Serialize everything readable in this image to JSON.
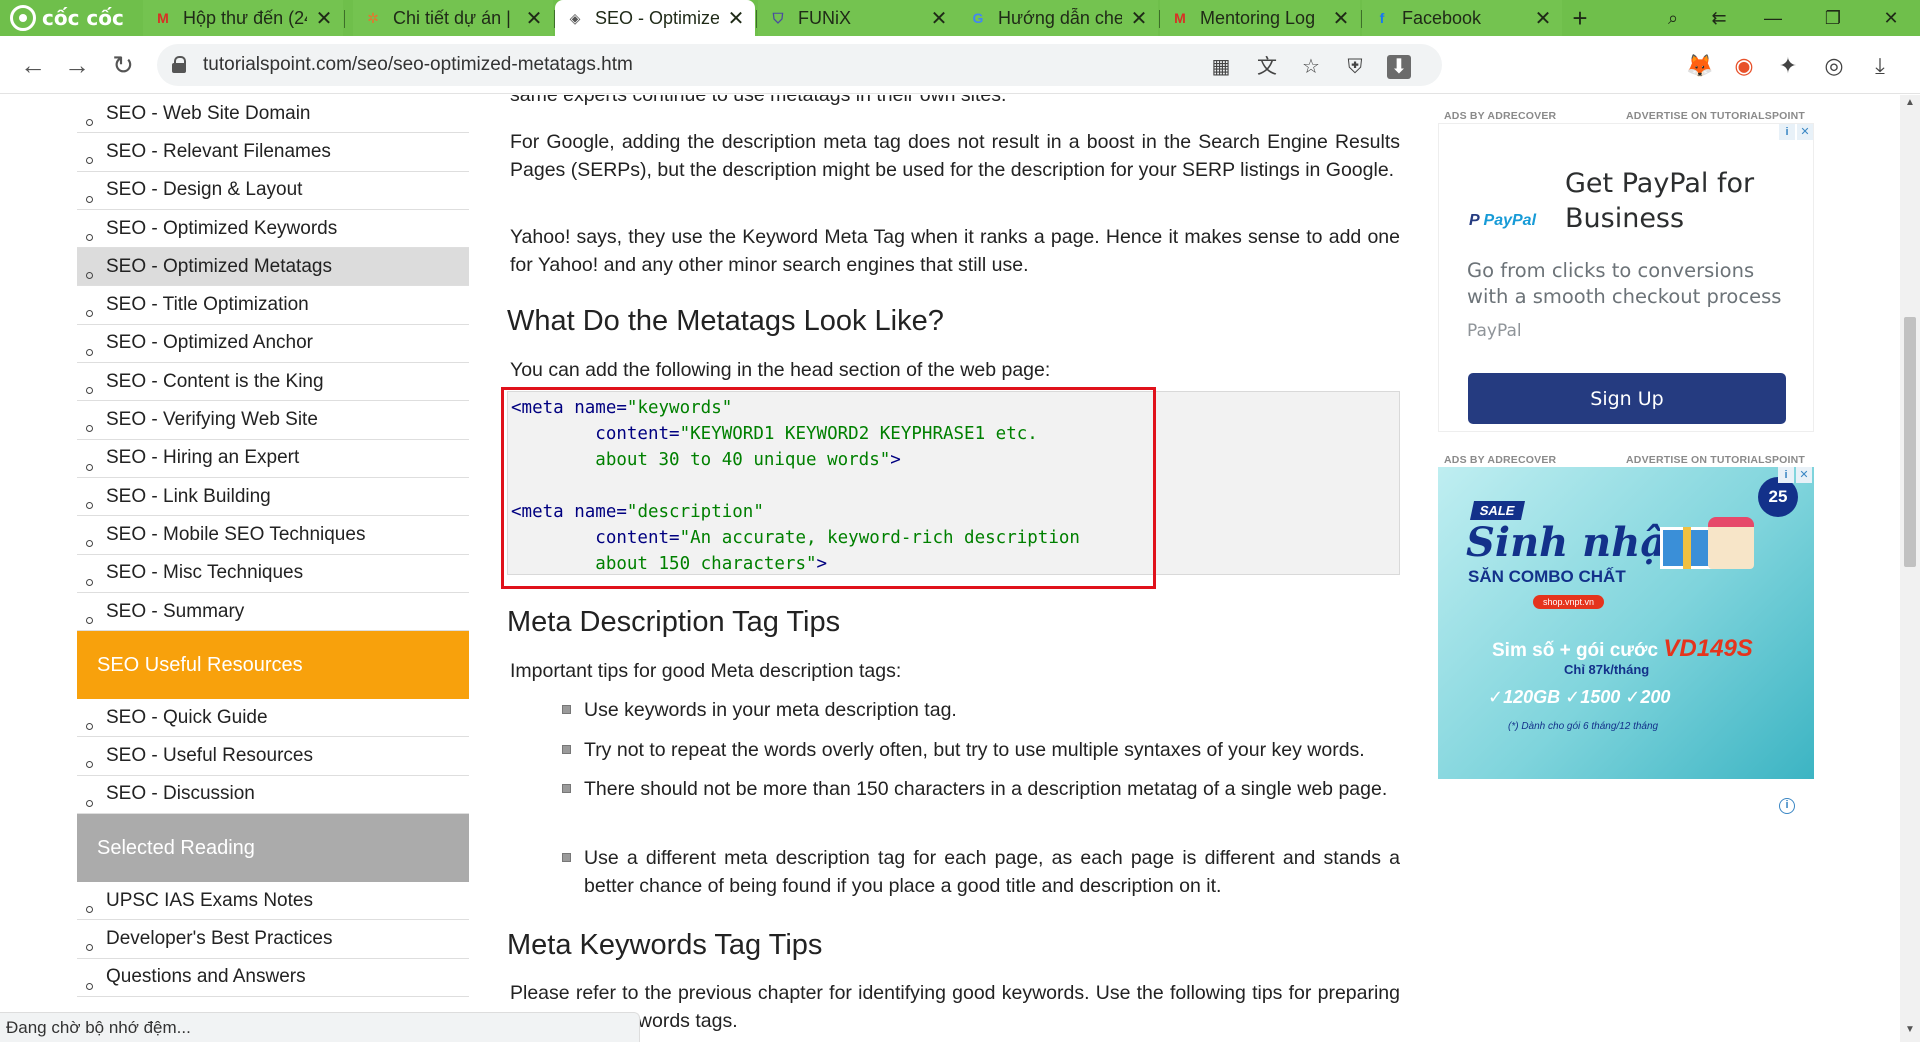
{
  "browser": {
    "brand": "cốc cốc",
    "tabs": [
      {
        "title": "Hộp thư đến (24",
        "favicon": "gmail-icon",
        "color": "#d93025",
        "glyph": "M"
      },
      {
        "title": "Chi tiết dự án | P",
        "favicon": "person-icon",
        "color": "#e8732e",
        "glyph": "✲"
      },
      {
        "title": "SEO - Optimized",
        "favicon": "tutorialspoint-icon",
        "color": "#555555",
        "glyph": "◈",
        "active": true
      },
      {
        "title": "FUNiX",
        "favicon": "shield-icon",
        "color": "#4a4aa0",
        "glyph": "⛉"
      },
      {
        "title": "Hướng dẫn chec",
        "favicon": "google-icon",
        "color": "#4285f4",
        "glyph": "G"
      },
      {
        "title": "Mentoring Log",
        "favicon": "gmail-icon",
        "color": "#d93025",
        "glyph": "M"
      },
      {
        "title": "Facebook",
        "favicon": "facebook-icon",
        "color": "#1877f2",
        "glyph": "f"
      }
    ],
    "url": "tutorialspoint.com/seo/seo-optimized-metatags.htm",
    "status": "Đang chờ bộ nhớ đệm..."
  },
  "sidebar": {
    "items_top": [
      "SEO - Web Site Domain",
      "SEO - Relevant Filenames",
      "SEO - Design & Layout",
      "SEO - Optimized Keywords",
      "SEO - Optimized Metatags",
      "SEO - Title Optimization",
      "SEO - Optimized Anchor",
      "SEO - Content is the King",
      "SEO - Verifying Web Site",
      "SEO - Hiring an Expert",
      "SEO - Link Building",
      "SEO - Mobile SEO Techniques",
      "SEO - Misc Techniques",
      "SEO - Summary"
    ],
    "selected_index": 4,
    "resources_heading": "SEO Useful Resources",
    "resources": [
      "SEO - Quick Guide",
      "SEO - Useful Resources",
      "SEO - Discussion"
    ],
    "reading_heading": "Selected Reading",
    "reading": [
      "UPSC IAS Exams Notes",
      "Developer's Best Practices",
      "Questions and Answers"
    ]
  },
  "content": {
    "intro_cut": "same experts continue to use metatags in their own sites.",
    "para_google": "For Google, adding the description meta tag does not result in a boost in the Search Engine Results Pages (SERPs), but the description might be used for the description for your SERP listings in Google.",
    "para_yahoo": "Yahoo! says, they use the Keyword Meta Tag when it ranks a page. Hence it makes sense to add one for Yahoo! and any other minor search engines that still use.",
    "h_look": "What Do the Metatags Look Like?",
    "para_head": "You can add the following in the head section of the web page:",
    "code": {
      "l1_tag": "<meta",
      "l1_attr": " name=",
      "l1_str": "\"keywords\"",
      "l2_attr": "        content=",
      "l2_str": "\"KEYWORD1 KEYWORD2 KEYPHRASE1 etc.",
      "l3_str": "        about 30 to 40 unique words\"",
      "l3_tag": ">",
      "l5_tag": "<meta",
      "l5_attr": " name=",
      "l5_str": "\"description\"",
      "l6_attr": "        content=",
      "l6_str": "\"An accurate, keyword-rich description",
      "l7_str": "        about 150 characters\"",
      "l7_tag": ">"
    },
    "h_desc": "Meta Description Tag Tips",
    "para_tips": "Important tips for good Meta description tags:",
    "tips": [
      "Use keywords in your meta description tag.",
      "Try not to repeat the words overly often, but try to use multiple syntaxes of your key words.",
      "There should not be more than 150 characters in a description metatag of a single web page.",
      "Use a different meta description tag for each page, as each page is different and stands a better chance of being found if you place a good title and description on it."
    ],
    "h_kw": "Meta Keywords Tag Tips",
    "para_kw": "Please refer to the previous chapter for identifying good keywords. Use the following tips for preparing good meta keywords tags."
  },
  "ads": {
    "label_left": "ADS BY ADRECOVER",
    "label_right": "ADVERTISE ON TUTORIALSPOINT",
    "paypal": {
      "logo_a": "Pay",
      "logo_b": "Pal",
      "title": "Get PayPal for Business",
      "desc": "Go from clicks to conversions with a smooth checkout process",
      "brand": "PayPal",
      "cta": "Sign Up"
    },
    "vnpt": {
      "sale": "SALE",
      "headline": "Sinh nhật",
      "combo": "SĂN COMBO CHẤT",
      "pill": "shop.vnpt.vn",
      "sim": "Sim số + gói cước",
      "code": "VD149S",
      "price": "Chỉ 87k/tháng",
      "gb": "✓120GB  ✓1500  ✓200",
      "note": "(*) Dành cho gói 6 tháng/12 tháng",
      "badge": "25"
    }
  }
}
